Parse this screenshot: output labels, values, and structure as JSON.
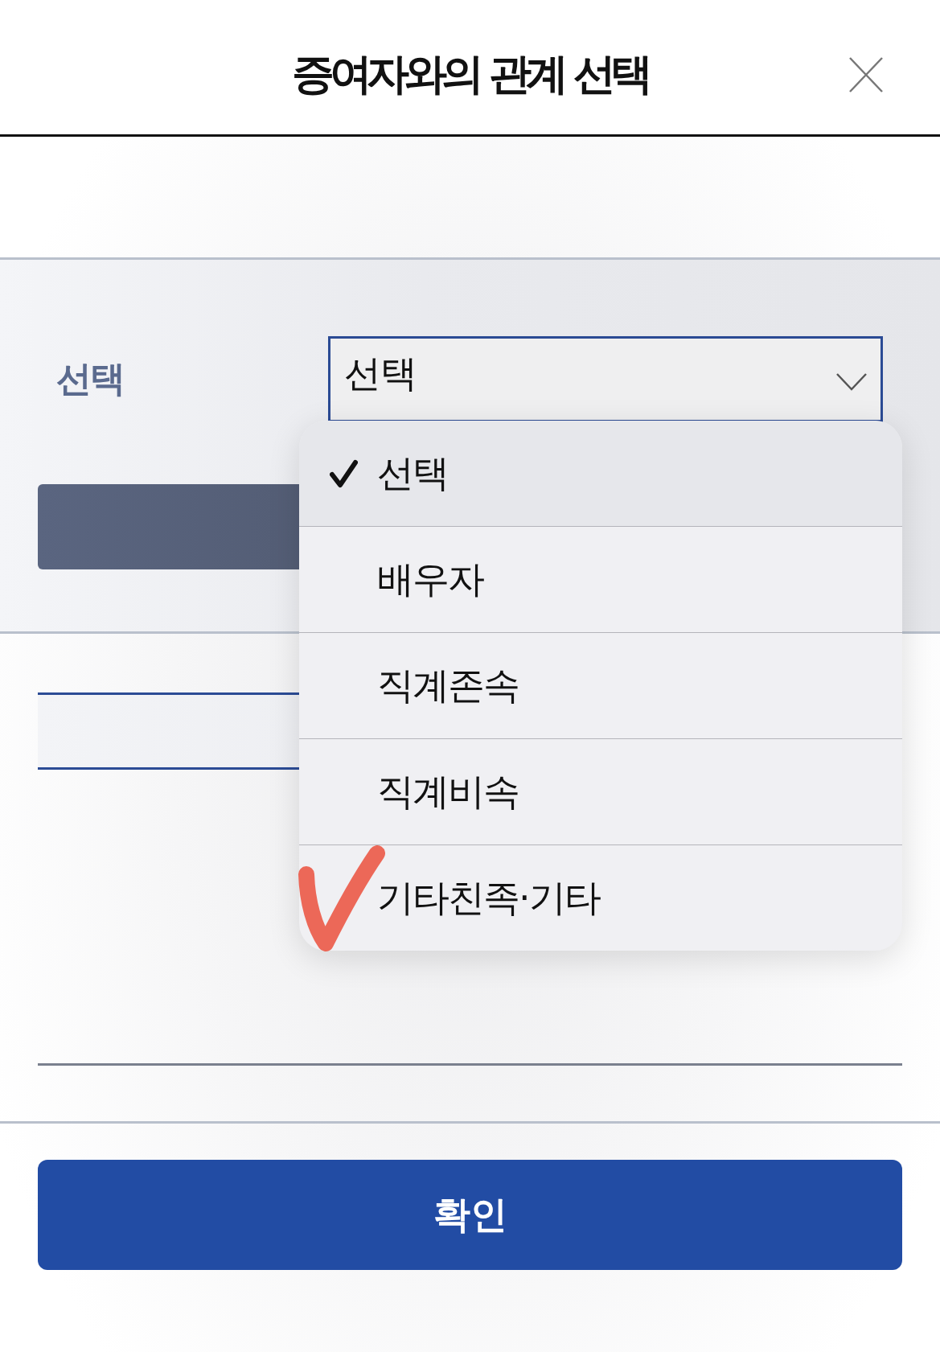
{
  "header": {
    "title": "증여자와의 관계 선택"
  },
  "form": {
    "label": "선택",
    "select": {
      "value": "선택"
    }
  },
  "dropdown": {
    "options": [
      {
        "label": "선택",
        "selected": true
      },
      {
        "label": "배우자",
        "selected": false
      },
      {
        "label": "직계존속",
        "selected": false
      },
      {
        "label": "직계비속",
        "selected": false
      },
      {
        "label": "기타친족·기타",
        "selected": false
      }
    ]
  },
  "confirm_button": {
    "label": "확인"
  }
}
